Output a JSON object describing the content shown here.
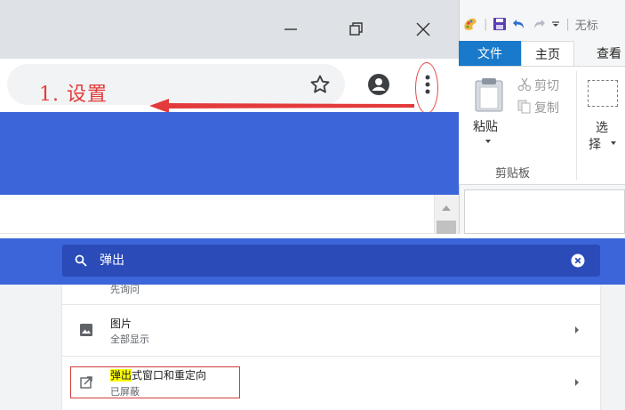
{
  "annotation": {
    "step_label": "1. 设置"
  },
  "paint": {
    "qat_more": "无标",
    "tabs": {
      "file": "文件",
      "home": "主页",
      "view": "查看"
    },
    "clipboard": {
      "paste_label": "粘贴",
      "cut_label": "剪切",
      "copy_label": "复制",
      "group_label": "剪贴板"
    },
    "select_label_1": "选",
    "select_label_2": "择"
  },
  "settings": {
    "search": {
      "query": "弹出"
    },
    "rows": [
      {
        "title": "",
        "subtitle": "先询问"
      },
      {
        "title": "图片",
        "subtitle": "全部显示"
      },
      {
        "title_highlight": "弹出",
        "title_rest": "式窗口和重定向",
        "subtitle": "已屏蔽"
      }
    ]
  },
  "colors": {
    "chrome_blue": "#3b65d8",
    "search_blue": "#2a4bb8",
    "ribbon_file_blue": "#1979ca",
    "annotation_red": "#e33b3b",
    "highlight_yellow": "#ffff00"
  }
}
